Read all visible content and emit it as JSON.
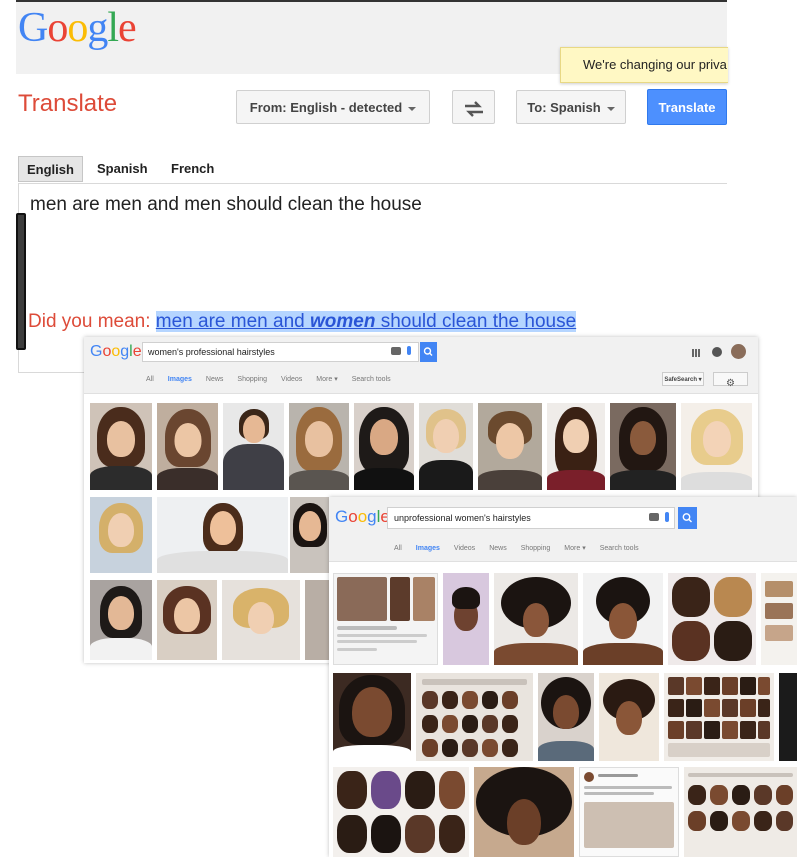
{
  "translate": {
    "logo_letters": [
      "G",
      "o",
      "o",
      "g",
      "l",
      "e"
    ],
    "privacy_notice": "We're changing our priva",
    "title": "Translate",
    "from_label": "From: English - detected",
    "swap_icon": "swap-arrows-icon",
    "to_label": "To: Spanish",
    "translate_button": "Translate",
    "lang_tabs": [
      "English",
      "Spanish",
      "French"
    ],
    "input_text": "men are men and men should clean the house",
    "did_you_mean_label": "Did you mean:",
    "suggestion_before": "men are men and ",
    "suggestion_emphasis": "women",
    "suggestion_after": " should clean the house"
  },
  "search_professional": {
    "logo_letters": [
      "G",
      "o",
      "o",
      "g",
      "l",
      "e"
    ],
    "query": "women's professional hairstyles",
    "nav": [
      "All",
      "Images",
      "News",
      "Shopping",
      "Videos",
      "More ▾",
      "Search tools"
    ],
    "active_tab": "Images",
    "safesearch": "SafeSearch ▾",
    "colors": {
      "skin_light": "#e8c1a0",
      "hair_brown": "#5a3a22",
      "hair_blonde": "#d9b36a",
      "hair_black": "#1e1a18"
    }
  },
  "search_unprofessional": {
    "logo_letters": [
      "G",
      "o",
      "o",
      "g",
      "l",
      "e"
    ],
    "query": "unprofessional women's hairstyles",
    "nav": [
      "All",
      "Images",
      "Videos",
      "News",
      "Shopping",
      "More ▾",
      "Search tools"
    ],
    "active_tab": "Images",
    "colors": {
      "skin_dark": "#7a4a30",
      "hair_black": "#1b1411",
      "collage_bg": "#e9e4de"
    }
  }
}
